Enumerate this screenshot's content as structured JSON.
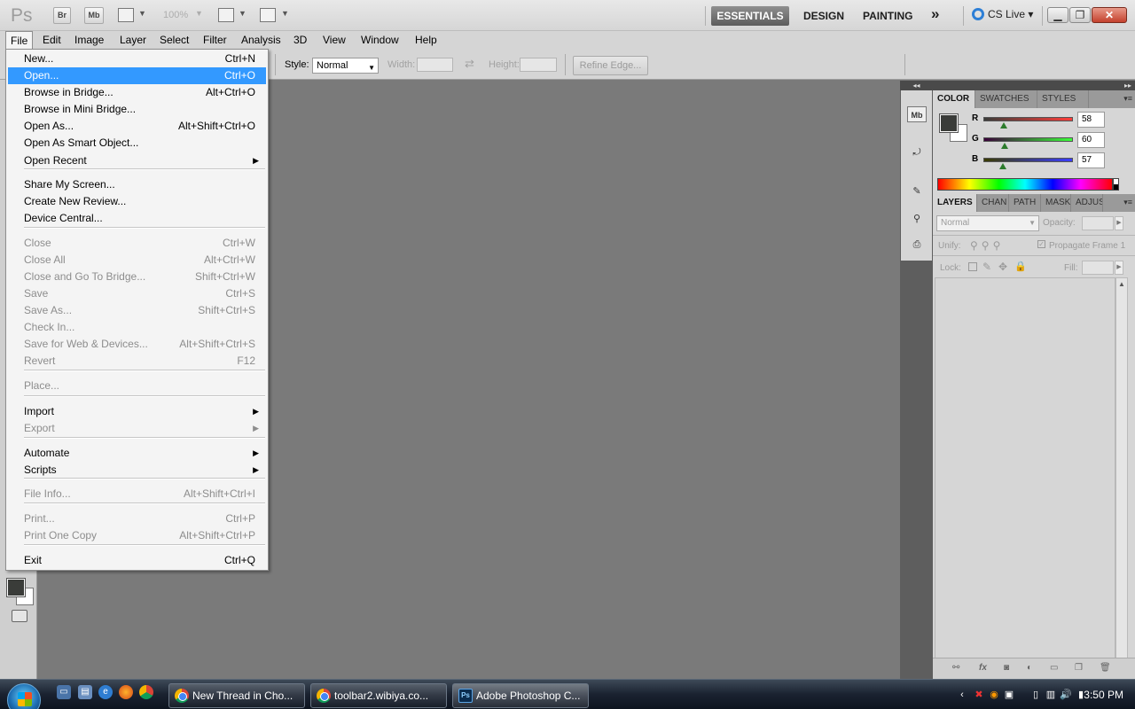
{
  "app": {
    "logo": "Ps",
    "bridge_label": "Br",
    "minibridge_label": "Mb",
    "zoom": "100%"
  },
  "workspaces": {
    "essentials": "ESSENTIALS",
    "design": "DESIGN",
    "painting": "PAINTING",
    "more": "»",
    "cs_live": "CS Live"
  },
  "menubar": [
    "File",
    "Edit",
    "Image",
    "Layer",
    "Select",
    "Filter",
    "Analysis",
    "3D",
    "View",
    "Window",
    "Help"
  ],
  "options": {
    "style_label": "Style:",
    "style_value": "Normal",
    "width_label": "Width:",
    "height_label": "Height:",
    "refine_edge": "Refine Edge..."
  },
  "file_menu": {
    "items": [
      {
        "label": "New...",
        "shortcut": "Ctrl+N",
        "enabled": true,
        "submenu": false
      },
      {
        "label": "Open...",
        "shortcut": "Ctrl+O",
        "enabled": true,
        "submenu": false,
        "highlighted": true
      },
      {
        "label": "Browse in Bridge...",
        "shortcut": "Alt+Ctrl+O",
        "enabled": true,
        "submenu": false
      },
      {
        "label": "Browse in Mini Bridge...",
        "shortcut": "",
        "enabled": true,
        "submenu": false
      },
      {
        "label": "Open As...",
        "shortcut": "Alt+Shift+Ctrl+O",
        "enabled": true,
        "submenu": false
      },
      {
        "label": "Open As Smart Object...",
        "shortcut": "",
        "enabled": true,
        "submenu": false
      },
      {
        "label": "Open Recent",
        "shortcut": "",
        "enabled": true,
        "submenu": true
      },
      {
        "label": "Share My Screen...",
        "shortcut": "",
        "enabled": true,
        "submenu": false
      },
      {
        "label": "Create New Review...",
        "shortcut": "",
        "enabled": true,
        "submenu": false
      },
      {
        "label": "Device Central...",
        "shortcut": "",
        "enabled": true,
        "submenu": false
      },
      {
        "label": "Close",
        "shortcut": "Ctrl+W",
        "enabled": false,
        "submenu": false
      },
      {
        "label": "Close All",
        "shortcut": "Alt+Ctrl+W",
        "enabled": false,
        "submenu": false
      },
      {
        "label": "Close and Go To Bridge...",
        "shortcut": "Shift+Ctrl+W",
        "enabled": false,
        "submenu": false
      },
      {
        "label": "Save",
        "shortcut": "Ctrl+S",
        "enabled": false,
        "submenu": false
      },
      {
        "label": "Save As...",
        "shortcut": "Shift+Ctrl+S",
        "enabled": false,
        "submenu": false
      },
      {
        "label": "Check In...",
        "shortcut": "",
        "enabled": false,
        "submenu": false
      },
      {
        "label": "Save for Web & Devices...",
        "shortcut": "Alt+Shift+Ctrl+S",
        "enabled": false,
        "submenu": false
      },
      {
        "label": "Revert",
        "shortcut": "F12",
        "enabled": false,
        "submenu": false
      },
      {
        "label": "Place...",
        "shortcut": "",
        "enabled": false,
        "submenu": false
      },
      {
        "label": "Import",
        "shortcut": "",
        "enabled": true,
        "submenu": true
      },
      {
        "label": "Export",
        "shortcut": "",
        "enabled": false,
        "submenu": true
      },
      {
        "label": "Automate",
        "shortcut": "",
        "enabled": true,
        "submenu": true
      },
      {
        "label": "Scripts",
        "shortcut": "",
        "enabled": true,
        "submenu": true
      },
      {
        "label": "File Info...",
        "shortcut": "Alt+Shift+Ctrl+I",
        "enabled": false,
        "submenu": false
      },
      {
        "label": "Print...",
        "shortcut": "Ctrl+P",
        "enabled": false,
        "submenu": false
      },
      {
        "label": "Print One Copy",
        "shortcut": "Alt+Shift+Ctrl+P",
        "enabled": false,
        "submenu": false
      },
      {
        "label": "Exit",
        "shortcut": "Ctrl+Q",
        "enabled": true,
        "submenu": false
      }
    ]
  },
  "dock": {
    "mb_label": "Mb"
  },
  "color_panel": {
    "tabs": [
      "COLOR",
      "SWATCHES",
      "STYLES"
    ],
    "r_label": "R",
    "r_value": "58",
    "g_label": "G",
    "g_value": "60",
    "b_label": "B",
    "b_value": "57",
    "foreground_color": "#3a3c39",
    "background_color": "#ffffff"
  },
  "layers_panel": {
    "tabs": [
      "LAYERS",
      "CHAN",
      "PATH",
      "MASK",
      "ADJUS"
    ],
    "blend_mode": "Normal",
    "opacity_label": "Opacity:",
    "unify_label": "Unify:",
    "propagate_label": "Propagate Frame 1",
    "lock_label": "Lock:",
    "fill_label": "Fill:",
    "footer_fx": "fx"
  },
  "taskbar": {
    "buttons": [
      {
        "label": "New Thread in Cho...",
        "icon": "chrome-icon"
      },
      {
        "label": "toolbar2.wibiya.co...",
        "icon": "chrome-icon"
      },
      {
        "label": "Adobe Photoshop C...",
        "icon": "photoshop-icon",
        "ps_label": "Ps"
      }
    ],
    "clock": "3:50 PM"
  }
}
